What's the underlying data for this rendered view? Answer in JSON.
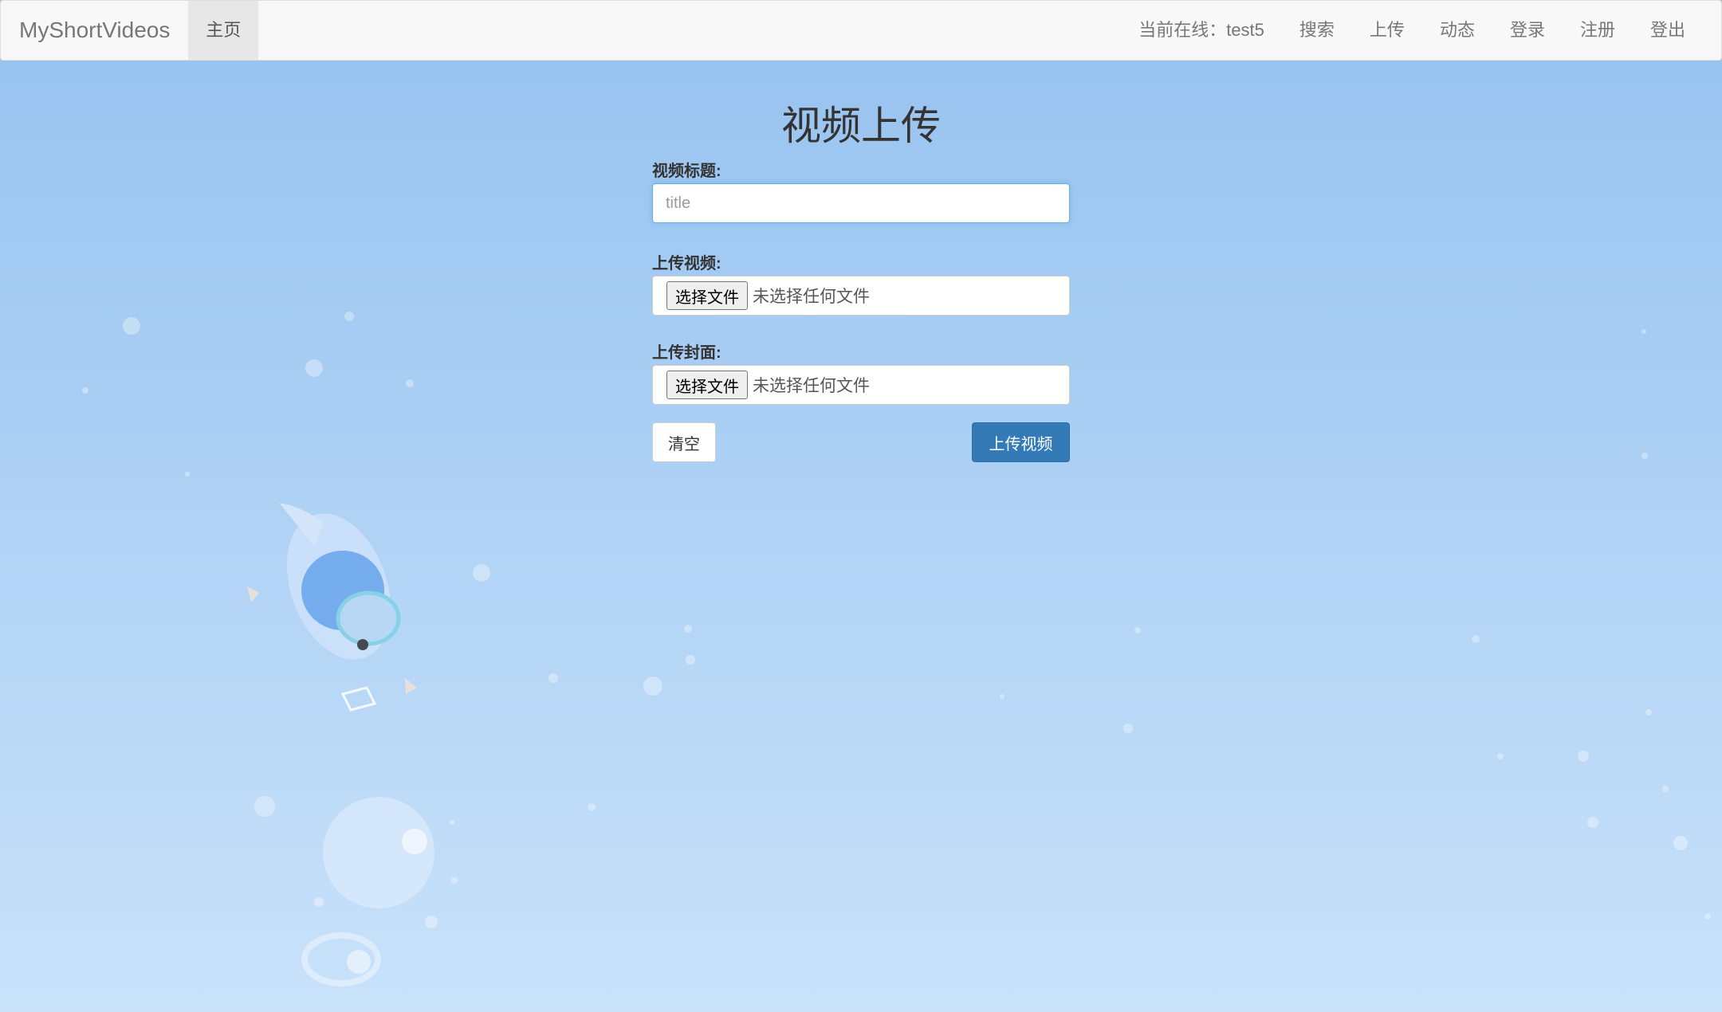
{
  "navbar": {
    "brand": "MyShortVideos",
    "home": "主页",
    "online_user": "当前在线：test5",
    "links": {
      "search": "搜索",
      "upload": "上传",
      "feed": "动态",
      "login": "登录",
      "register": "注册",
      "logout": "登出"
    }
  },
  "form": {
    "title": "视频上传",
    "video_title_label": "视频标题:",
    "video_title_placeholder": "title",
    "video_title_value": "",
    "video_file_label": "上传视频:",
    "cover_file_label": "上传封面:",
    "choose_file_button": "选择文件",
    "no_file_text": "未选择任何文件",
    "clear_button": "清空",
    "submit_button": "上传视频"
  },
  "colors": {
    "primary": "#337ab7",
    "background_top": "#96c2ef",
    "background_bottom": "#c9e2fa",
    "navbar_bg": "#f8f8f8"
  }
}
